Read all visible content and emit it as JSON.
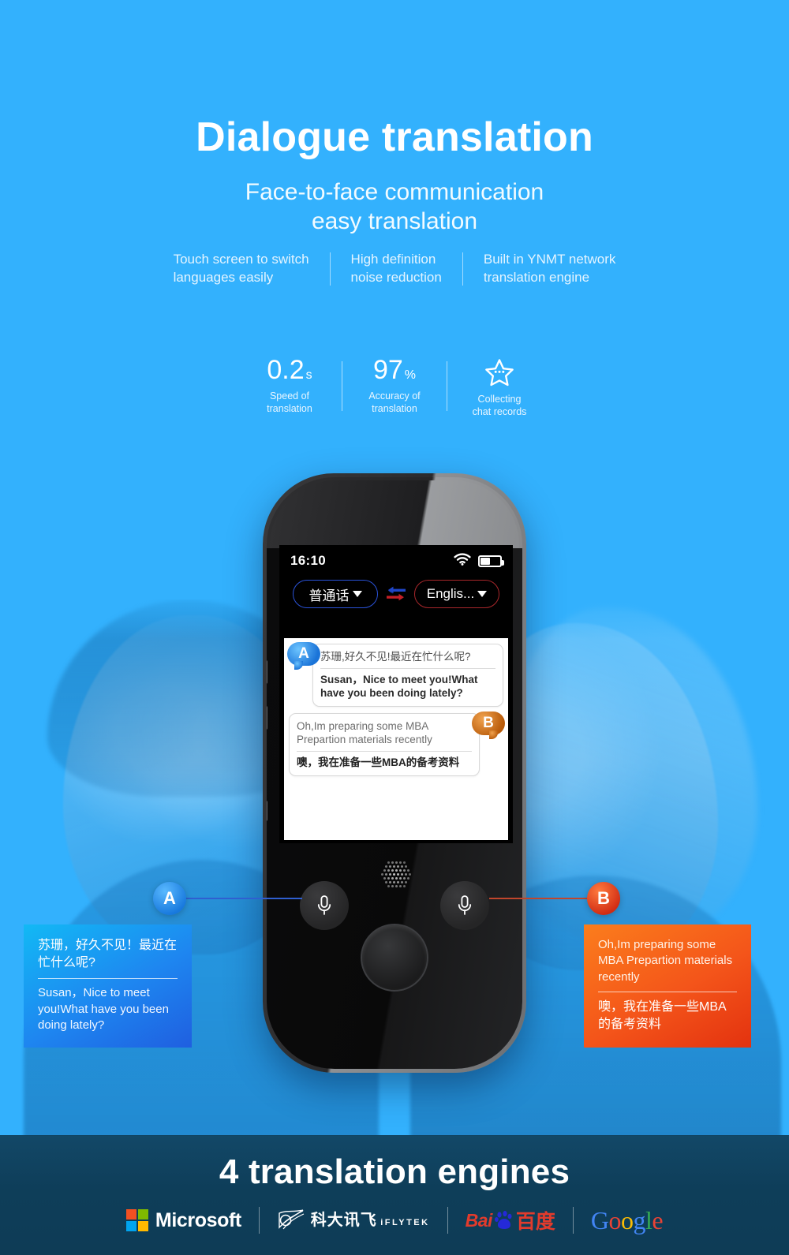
{
  "theme": {
    "background": "#33b1fd",
    "banner_background": "#0e3c56",
    "accent_blue": "#1e86f0",
    "accent_orange": "#f4551a"
  },
  "header": {
    "title": "Dialogue translation",
    "subtitle_line1": "Face-to-face communication",
    "subtitle_line2": "easy translation",
    "features": [
      {
        "line1": "Touch screen to switch",
        "line2": "languages easily"
      },
      {
        "line1": "High definition",
        "line2": "noise reduction"
      },
      {
        "line1": "Built in YNMT network",
        "line2": "translation engine"
      }
    ]
  },
  "stats": [
    {
      "value": "0.2",
      "unit": "s",
      "cap1": "Speed of",
      "cap2": "translation",
      "icon": ""
    },
    {
      "value": "97",
      "unit": "%",
      "cap1": "Accuracy of",
      "cap2": "translation",
      "icon": ""
    },
    {
      "value": "",
      "unit": "",
      "cap1": "Collecting",
      "cap2": "chat records",
      "icon": "star-icon"
    }
  ],
  "device": {
    "status": {
      "time": "16:10",
      "wifi_icon": "wifi-icon",
      "battery_icon": "battery-icon",
      "battery_level": "46%"
    },
    "language_bar": {
      "source": "普通话",
      "target": "Englis...",
      "swap_icon": "swap-arrows-icon"
    },
    "messages": [
      {
        "speaker": "A",
        "cn": "苏珊,好久不见!最近在忙什么呢?",
        "en": "Susan，Nice to meet you!What have you been doing lately?",
        "order": "cn-first"
      },
      {
        "speaker": "B",
        "cn": "噢，我在准备一些MBA的备考资料",
        "en": "Oh,Im preparing some MBA Prepartion materials recently",
        "order": "en-first"
      }
    ],
    "controls": {
      "mic_left": "mic-icon",
      "mic_right": "mic-icon",
      "speaker_grille": "speaker-grille-icon",
      "home_button": "home-button"
    }
  },
  "callouts": [
    {
      "badge": "A",
      "cn": "苏珊，好久不见！最近在忙什么呢?",
      "en": "Susan，Nice to meet you!What have you been doing lately?"
    },
    {
      "badge": "B",
      "en": "Oh,Im preparing some MBA Prepartion materials recently",
      "cn": "噢，我在准备一些MBA的备考资料"
    }
  ],
  "banner": {
    "title": "4 translation engines",
    "logos": [
      {
        "name": "Microsoft",
        "label": "Microsoft"
      },
      {
        "name": "iflytek",
        "cn": "科大讯飞",
        "en": "iFLYTEK"
      },
      {
        "name": "Baidu",
        "latin": "Bai",
        "cn": "百度"
      },
      {
        "name": "Google",
        "letters": [
          "G",
          "o",
          "o",
          "g",
          "l",
          "e"
        ]
      }
    ]
  }
}
